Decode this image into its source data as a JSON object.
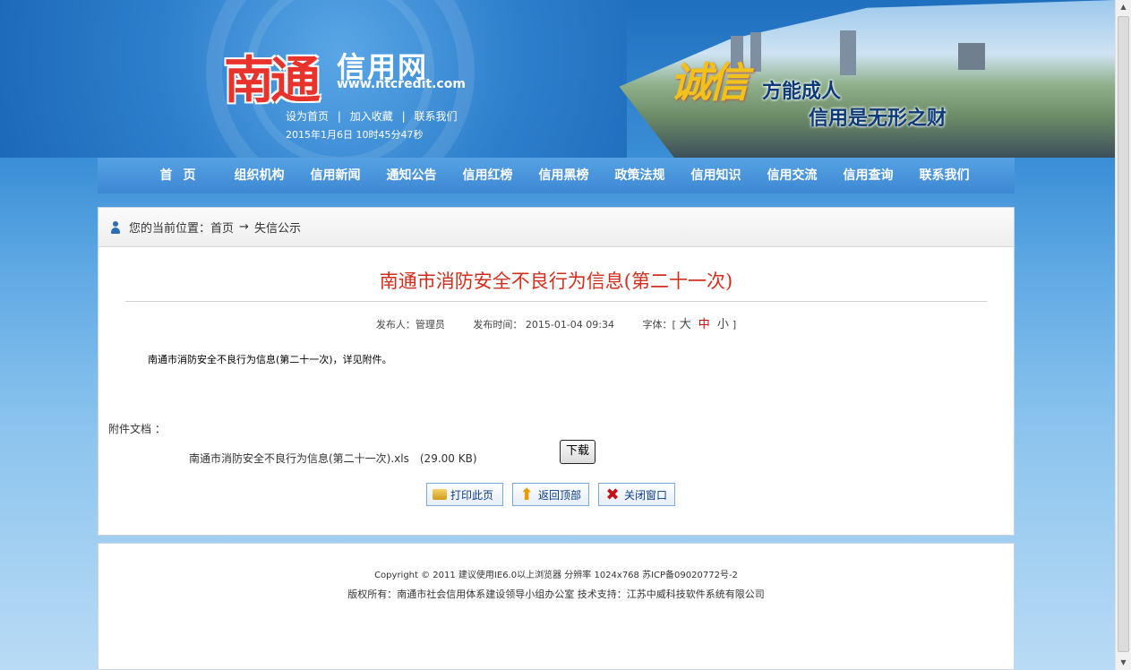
{
  "header": {
    "logo_city": "南通",
    "logo_name": "信用网",
    "logo_url": "www.ntcredit.com",
    "links": [
      "设为首页",
      "加入收藏",
      "联系我们"
    ],
    "link_separator": "|",
    "datetime": "2015年1月6日 10时45分47秒",
    "slogan_mark": "诚信",
    "slogan_line1": "方能成人",
    "slogan_line2": "信用是无形之财"
  },
  "nav": {
    "items": [
      "首页",
      "组织机构",
      "信用新闻",
      "通知公告",
      "信用红榜",
      "信用黑榜",
      "政策法规",
      "信用知识",
      "信用交流",
      "信用查询",
      "联系我们"
    ]
  },
  "breadcrumb": {
    "prefix": "您的当前位置：",
    "home": "首页",
    "arrow": "→",
    "current": "失信公示"
  },
  "article": {
    "title": "南通市消防安全不良行为信息(第二十一次)",
    "publisher_label": "发布人：管理员",
    "time_label": "发布时间：",
    "time_value": "2015-01-04 09:34",
    "font_label": "字体：[",
    "font_large": "大",
    "font_mid": "中",
    "font_small": "小",
    "font_close": "]",
    "body": "南通市消防安全不良行为信息(第二十一次)，详见附件。"
  },
  "attachment": {
    "label": "附件文档 ：",
    "filename": "南通市消防安全不良行为信息(第二十一次).xls",
    "size": "(29.00 KB)",
    "download_label": "下载"
  },
  "actions": {
    "print": "打印此页",
    "top": "返回顶部",
    "close": "关闭窗口"
  },
  "footer": {
    "line1": "Copyright © 2011 建议使用IE6.0以上浏览器 分辨率 1024x768 苏ICP备09020772号-2",
    "line2": "版权所有：南通市社会信用体系建设领导小组办公室 技术支持：江苏中威科技软件系统有限公司"
  },
  "colors": {
    "title_red": "#d32d1c",
    "nav_blue": "#3d88d2",
    "logo_red": "#e8322b",
    "slogan_gold": "#f1c21b"
  }
}
